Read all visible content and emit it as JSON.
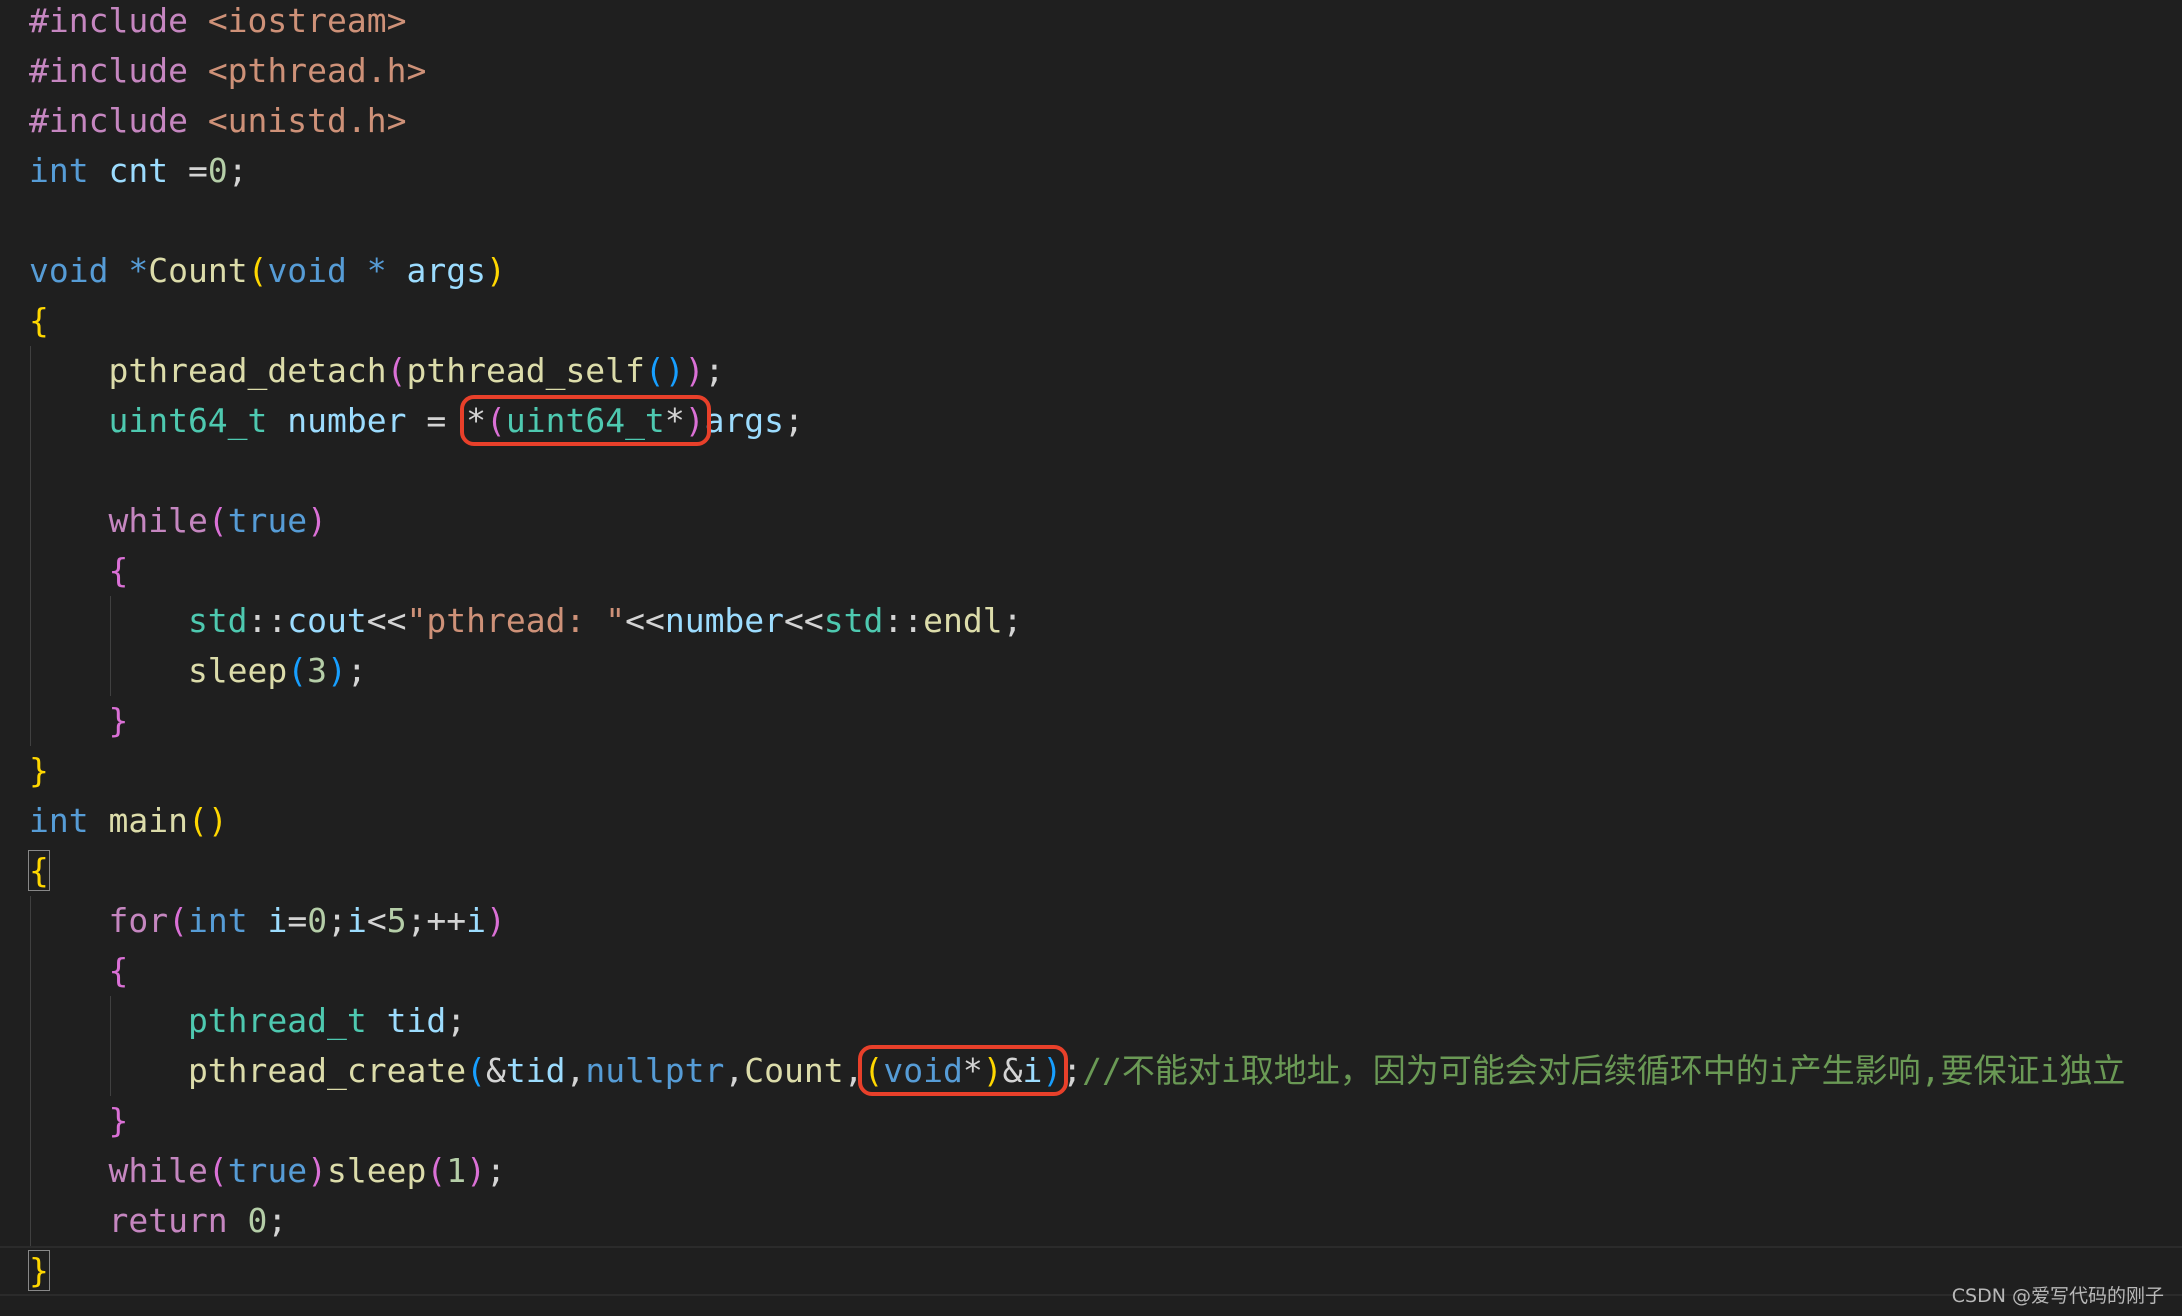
{
  "editor": {
    "colors": {
      "keyword": "#c586c0",
      "string": "#ce9178",
      "type": "#569cd6",
      "variable": "#9cdcfe",
      "function": "#dcdcaa",
      "class": "#4ec9b0",
      "number": "#b5cea8",
      "comment": "#6a9955",
      "highlight_box": "#e8402a",
      "background": "#1f1f1f"
    },
    "lines": [
      [
        [
          "#include ",
          "k"
        ],
        [
          "<iostream>",
          "s"
        ]
      ],
      [
        [
          "#include ",
          "k"
        ],
        [
          "<pthread.h>",
          "s"
        ]
      ],
      [
        [
          "#include ",
          "k"
        ],
        [
          "<unistd.h>",
          "s"
        ]
      ],
      [
        [
          "int ",
          "t"
        ],
        [
          "cnt ",
          "v"
        ],
        [
          "=",
          "p"
        ],
        [
          "0",
          "n"
        ],
        [
          ";",
          "p"
        ]
      ],
      [],
      [
        [
          "void ",
          "t"
        ],
        [
          "*",
          "t"
        ],
        [
          "Count",
          "f"
        ],
        [
          "(",
          "b1"
        ],
        [
          "void ",
          "t"
        ],
        [
          "* ",
          "t"
        ],
        [
          "args",
          "v"
        ],
        [
          ")",
          "b1"
        ]
      ],
      [
        [
          "{",
          "b1"
        ]
      ],
      [
        [
          "    pthread_detach",
          "f"
        ],
        [
          "(",
          "b2"
        ],
        [
          "pthread_self",
          "f"
        ],
        [
          "(",
          "b3"
        ],
        [
          ")",
          "b3"
        ],
        [
          ")",
          "b2"
        ],
        [
          ";",
          "p"
        ]
      ],
      [
        [
          "    uint64_t ",
          "ty"
        ],
        [
          "number ",
          "v"
        ],
        [
          "= ",
          "p"
        ],
        {
          "box": [
            [
              "*",
              "p"
            ],
            [
              "(",
              "b2"
            ],
            [
              "uint64_t",
              "ty"
            ],
            [
              "*",
              "p"
            ],
            [
              ")",
              "b2"
            ]
          ]
        },
        [
          "args",
          "v"
        ],
        [
          ";",
          "p"
        ]
      ],
      [],
      [
        [
          "    while",
          "k"
        ],
        [
          "(",
          "b2"
        ],
        [
          "true",
          "t"
        ],
        [
          ")",
          "b2"
        ]
      ],
      [
        [
          "    {",
          "b2"
        ]
      ],
      [
        [
          "        std",
          "ty"
        ],
        [
          "::",
          "p"
        ],
        [
          "cout",
          "v"
        ],
        [
          "<<",
          "p"
        ],
        [
          "\"pthread: \"",
          "s"
        ],
        [
          "<<",
          "p"
        ],
        [
          "number",
          "v"
        ],
        [
          "<<",
          "p"
        ],
        [
          "std",
          "ty"
        ],
        [
          "::",
          "p"
        ],
        [
          "endl",
          "f"
        ],
        [
          ";",
          "p"
        ]
      ],
      [
        [
          "        sleep",
          "f"
        ],
        [
          "(",
          "b3"
        ],
        [
          "3",
          "n"
        ],
        [
          ")",
          "b3"
        ],
        [
          ";",
          "p"
        ]
      ],
      [
        [
          "    }",
          "b2"
        ]
      ],
      [
        [
          "}",
          "b1"
        ]
      ],
      [
        [
          "int ",
          "t"
        ],
        [
          "main",
          "f"
        ],
        [
          "(",
          "b1"
        ],
        [
          ")",
          "b1"
        ]
      ],
      [
        {
          "match": [
            [
              "{",
              "b1"
            ]
          ]
        }
      ],
      [
        [
          "    for",
          "k"
        ],
        [
          "(",
          "b2"
        ],
        [
          "int ",
          "t"
        ],
        [
          "i",
          "v"
        ],
        [
          "=",
          "p"
        ],
        [
          "0",
          "n"
        ],
        [
          ";",
          "p"
        ],
        [
          "i",
          "v"
        ],
        [
          "<",
          "p"
        ],
        [
          "5",
          "n"
        ],
        [
          ";++",
          "p"
        ],
        [
          "i",
          "v"
        ],
        [
          ")",
          "b2"
        ]
      ],
      [
        [
          "    {",
          "b2"
        ]
      ],
      [
        [
          "        pthread_t ",
          "ty"
        ],
        [
          "tid",
          "v"
        ],
        [
          ";",
          "p"
        ]
      ],
      [
        [
          "        pthread_create",
          "f"
        ],
        [
          "(",
          "b3"
        ],
        [
          "&",
          "p"
        ],
        [
          "tid",
          "v"
        ],
        [
          ",",
          "p"
        ],
        [
          "nullptr",
          "t"
        ],
        [
          ",",
          "p"
        ],
        [
          "Count",
          "f"
        ],
        [
          ",",
          "p"
        ],
        {
          "box": [
            [
              "(",
              "b1"
            ],
            [
              "void",
              "t"
            ],
            [
              "*",
              "p"
            ],
            [
              ")",
              "b1"
            ],
            [
              "&",
              "p"
            ],
            [
              "i",
              "v"
            ],
            [
              ")",
              "b3"
            ]
          ]
        },
        [
          ";",
          "p"
        ],
        [
          "//不能对i取地址，因为可能会对后续循环中的i产生影响,要保证i独立",
          "c"
        ]
      ],
      [
        [
          "    }",
          "b2"
        ]
      ],
      [
        [
          "    while",
          "k"
        ],
        [
          "(",
          "b2"
        ],
        [
          "true",
          "t"
        ],
        [
          ")",
          "b2"
        ],
        [
          "sleep",
          "f"
        ],
        [
          "(",
          "b2"
        ],
        [
          "1",
          "n"
        ],
        [
          ")",
          "b2"
        ],
        [
          ";",
          "p"
        ]
      ],
      [
        [
          "    return ",
          "k"
        ],
        [
          "0",
          "n"
        ],
        [
          ";",
          "p"
        ]
      ],
      [
        {
          "match": [
            [
              "}",
              "b1"
            ]
          ]
        }
      ]
    ],
    "current_line": 25
  },
  "watermark": "CSDN @爱写代码的刚子"
}
